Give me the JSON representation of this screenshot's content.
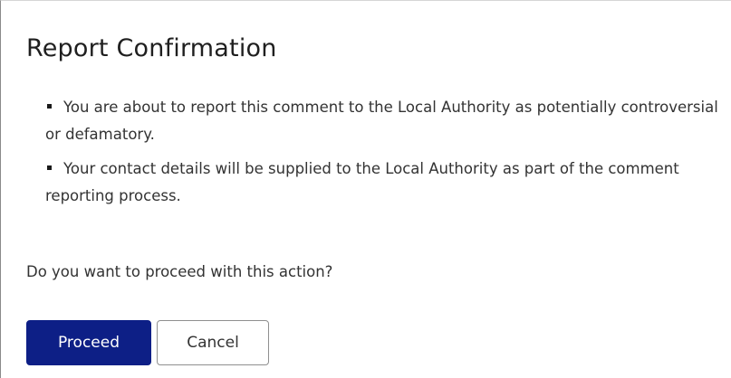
{
  "dialog": {
    "title": "Report Confirmation",
    "bullets": [
      "You are about to report this comment to the Local Authority as potentially controversial or defamatory.",
      "Your contact details will be supplied to the Local Authority as part of the comment reporting process."
    ],
    "question": "Do you want to proceed with this action?",
    "proceed_label": "Proceed",
    "cancel_label": "Cancel"
  },
  "colors": {
    "primary_button": "#0d1f86",
    "text": "#333333"
  }
}
